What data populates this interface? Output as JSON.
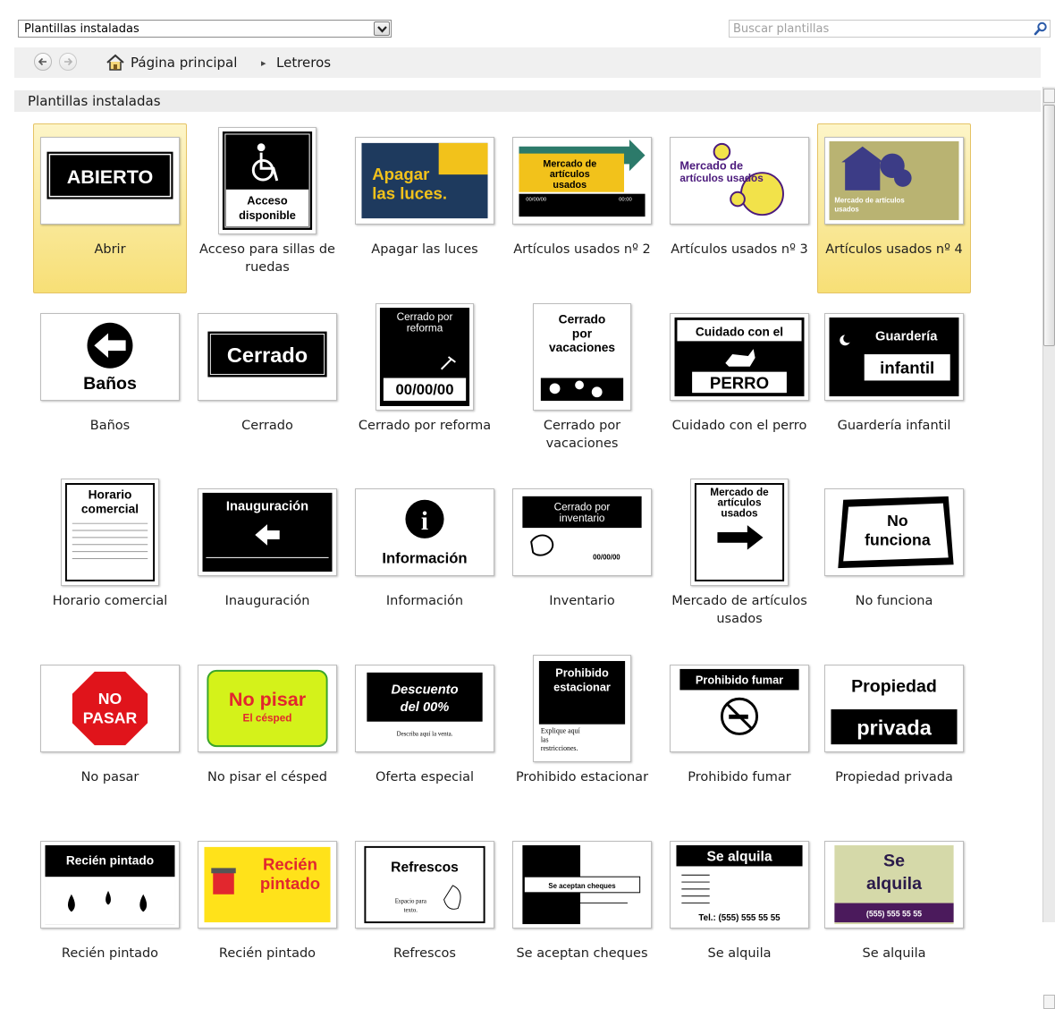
{
  "toolbar": {
    "dropdown_value": "Plantillas instaladas",
    "search_placeholder": "Buscar plantillas"
  },
  "breadcrumb": {
    "home": "Página principal",
    "separator": "▸",
    "current": "Letreros"
  },
  "section_title": "Plantillas instaladas",
  "icons": {
    "back": "back-arrow-icon",
    "forward": "forward-arrow-icon",
    "home": "home-icon",
    "search": "search-icon",
    "dropdown": "chevron-down-icon"
  },
  "colors": {
    "selection": "#f7df76",
    "selection_border": "#e5c365",
    "nav_bg": "#f0f0f0"
  },
  "templates": [
    {
      "label": "Abrir",
      "thumb_text": [
        "ABIERTO"
      ],
      "selected": true
    },
    {
      "label": "Acceso para sillas de ruedas",
      "thumb_text": [
        "Acceso",
        "disponible"
      ]
    },
    {
      "label": "Apagar las luces",
      "thumb_text": [
        "Apagar",
        "las luces."
      ]
    },
    {
      "label": "Artículos usados nº 2",
      "thumb_text": [
        "Mercado de",
        "artículos",
        "usados",
        "00/00/00",
        "00:00"
      ]
    },
    {
      "label": "Artículos usados nº 3",
      "thumb_text": [
        "Mercado de",
        "artículos usados"
      ]
    },
    {
      "label": "Artículos usados nº 4",
      "thumb_text": [
        "Mercado de artículos",
        "usados"
      ],
      "selected": true
    },
    {
      "label": "Baños",
      "thumb_text": [
        "Baños"
      ]
    },
    {
      "label": "Cerrado",
      "thumb_text": [
        "Cerrado"
      ]
    },
    {
      "label": "Cerrado por reforma",
      "thumb_text": [
        "Cerrado por",
        "reforma",
        "00/00/00"
      ]
    },
    {
      "label": "Cerrado por vacaciones",
      "thumb_text": [
        "Cerrado",
        "por",
        "vacaciones"
      ]
    },
    {
      "label": "Cuidado con el perro",
      "thumb_text": [
        "Cuidado con el",
        "PERRO"
      ]
    },
    {
      "label": "Guardería infantil",
      "thumb_text": [
        "Guardería",
        "infantil"
      ]
    },
    {
      "label": "Horario comercial",
      "thumb_text": [
        "Horario",
        "comercial"
      ]
    },
    {
      "label": "Inauguración",
      "thumb_text": [
        "Inauguración"
      ]
    },
    {
      "label": "Información",
      "thumb_text": [
        "i",
        "Información"
      ]
    },
    {
      "label": "Inventario",
      "thumb_text": [
        "Cerrado por",
        "inventario",
        "00/00/00"
      ]
    },
    {
      "label": "Mercado de artículos usados",
      "thumb_text": [
        "Mercado de",
        "artículos",
        "usados"
      ]
    },
    {
      "label": "No funciona",
      "thumb_text": [
        "No",
        "funciona"
      ]
    },
    {
      "label": "No pasar",
      "thumb_text": [
        "NO",
        "PASAR"
      ]
    },
    {
      "label": "No pisar el césped",
      "thumb_text": [
        "No pisar",
        "El césped"
      ]
    },
    {
      "label": "Oferta especial",
      "thumb_text": [
        "Descuento",
        "del 00%",
        "Describa aquí la venta."
      ]
    },
    {
      "label": "Prohibido estacionar",
      "thumb_text": [
        "Prohibido",
        "estacionar",
        "Explique aquí",
        "las",
        "restricciones."
      ]
    },
    {
      "label": "Prohibido fumar",
      "thumb_text": [
        "Prohibido fumar"
      ]
    },
    {
      "label": "Propiedad privada",
      "thumb_text": [
        "Propiedad",
        "privada"
      ]
    },
    {
      "label": "Recién pintado",
      "thumb_text": [
        "Recién pintado"
      ]
    },
    {
      "label": "Recién pintado",
      "thumb_text": [
        "Recién",
        "pintado"
      ]
    },
    {
      "label": "Refrescos",
      "thumb_text": [
        "Refrescos",
        "Espacio para",
        "texto."
      ]
    },
    {
      "label": "Se aceptan cheques",
      "thumb_text": [
        "Se aceptan cheques"
      ]
    },
    {
      "label": "Se alquila",
      "thumb_text": [
        "Se alquila",
        "Tel.: (555) 555 55 55"
      ]
    },
    {
      "label": "Se alquila",
      "thumb_text": [
        "Se",
        "alquila",
        "(555) 555 55 55"
      ]
    }
  ]
}
